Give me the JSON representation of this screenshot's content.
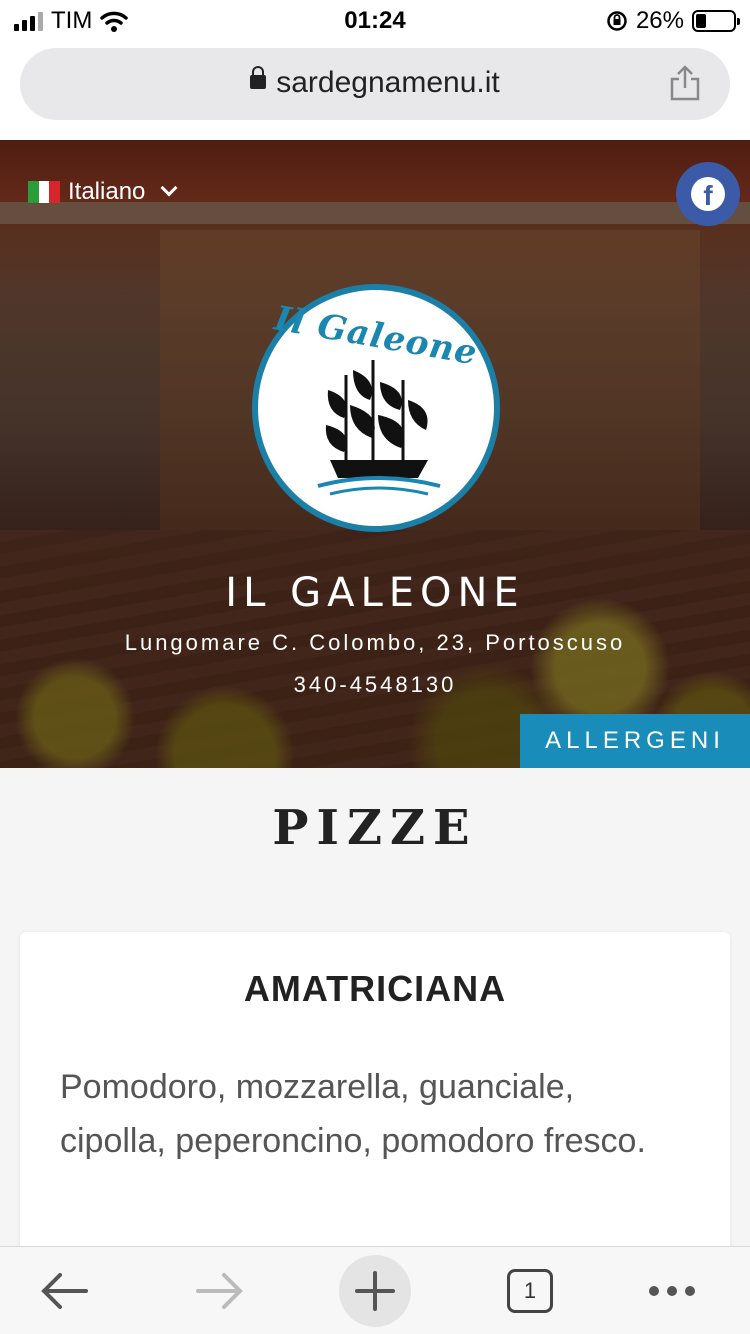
{
  "status_bar": {
    "carrier": "TIM",
    "time": "01:24",
    "battery": "26%"
  },
  "browser": {
    "url": "sardegnamenu.it",
    "tab_count": "1"
  },
  "hero": {
    "language": "Italiano",
    "logo_text": "Il Galeone",
    "restaurant_name": "IL GALEONE",
    "address": "Lungomare C. Colombo, 23, Portoscuso",
    "phone": "340-4548130",
    "allergeni_label": "ALLERGENI"
  },
  "menu": {
    "section_title": "PIZZE",
    "items": [
      {
        "name": "AMATRICIANA",
        "description": "Pomodoro, mozzarella, guanciale, cipolla, peperoncino, pomodoro fresco."
      }
    ]
  },
  "colors": {
    "accent": "#1a8cba",
    "facebook": "#3b5aa8"
  }
}
